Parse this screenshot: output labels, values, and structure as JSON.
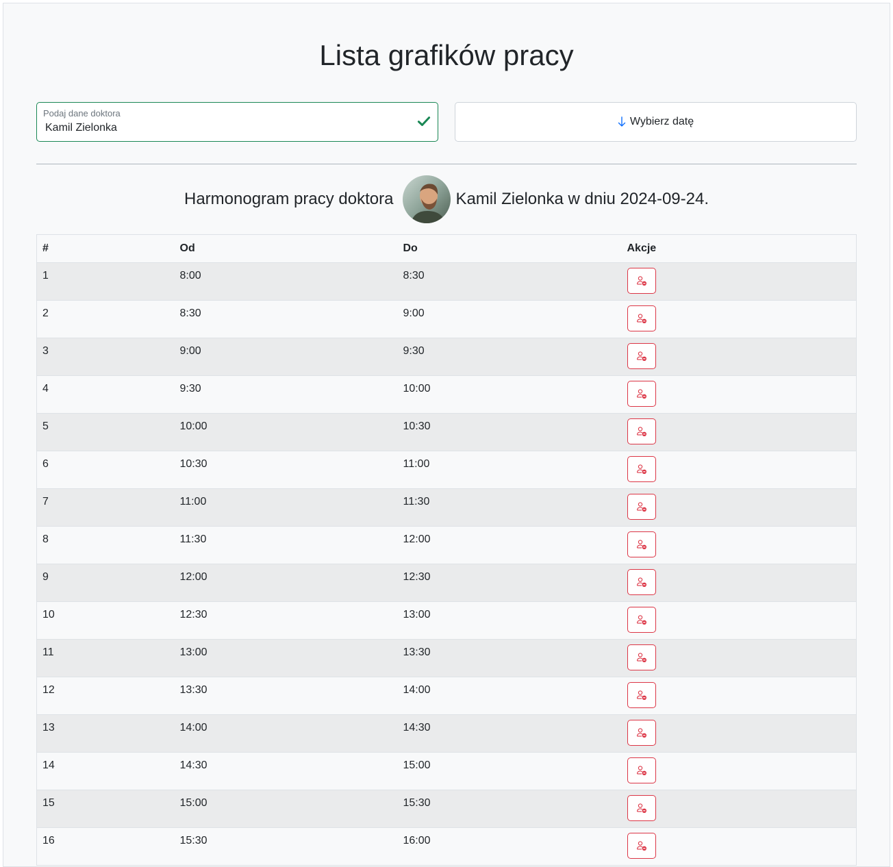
{
  "page": {
    "title": "Lista grafików pracy"
  },
  "doctor_field": {
    "label": "Podaj dane doktora",
    "value": "Kamil Zielonka",
    "valid": true
  },
  "date_button": {
    "label": "Wybierz datę",
    "icon": "arrow-down-icon"
  },
  "heading": {
    "prefix": "Harmonogram pracy doktora",
    "suffix": "Kamil Zielonka w dniu 2024-09-24."
  },
  "table": {
    "headers": [
      "#",
      "Od",
      "Do",
      "Akcje"
    ],
    "rows": [
      {
        "n": "1",
        "from": "8:00",
        "to": "8:30"
      },
      {
        "n": "2",
        "from": "8:30",
        "to": "9:00"
      },
      {
        "n": "3",
        "from": "9:00",
        "to": "9:30"
      },
      {
        "n": "4",
        "from": "9:30",
        "to": "10:00"
      },
      {
        "n": "5",
        "from": "10:00",
        "to": "10:30"
      },
      {
        "n": "6",
        "from": "10:30",
        "to": "11:00"
      },
      {
        "n": "7",
        "from": "11:00",
        "to": "11:30"
      },
      {
        "n": "8",
        "from": "11:30",
        "to": "12:00"
      },
      {
        "n": "9",
        "from": "12:00",
        "to": "12:30"
      },
      {
        "n": "10",
        "from": "12:30",
        "to": "13:00"
      },
      {
        "n": "11",
        "from": "13:00",
        "to": "13:30"
      },
      {
        "n": "12",
        "from": "13:30",
        "to": "14:00"
      },
      {
        "n": "13",
        "from": "14:00",
        "to": "14:30"
      },
      {
        "n": "14",
        "from": "14:30",
        "to": "15:00"
      },
      {
        "n": "15",
        "from": "15:00",
        "to": "15:30"
      },
      {
        "n": "16",
        "from": "15:30",
        "to": "16:00"
      }
    ],
    "action_icon": "remove-person-icon"
  },
  "colors": {
    "valid_green": "#198754",
    "danger_red": "#dc3545",
    "accent_blue": "#0d6efd"
  }
}
